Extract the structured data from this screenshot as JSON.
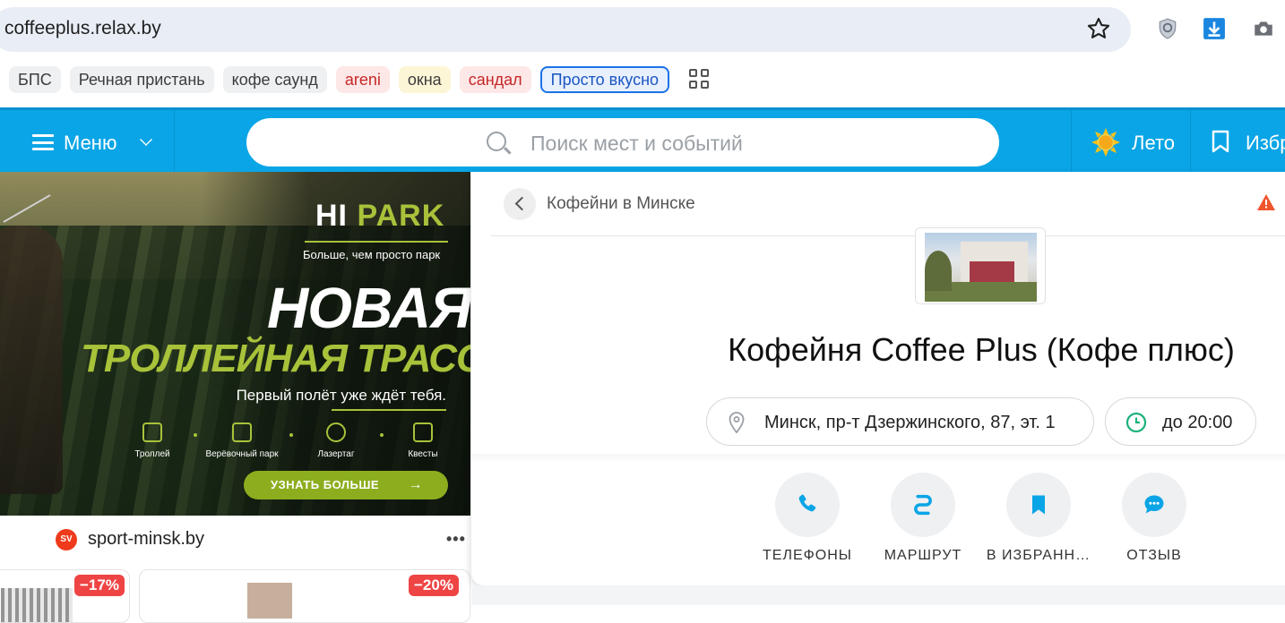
{
  "browser": {
    "url": "coffeeplus.relax.by",
    "bookmarks": [
      {
        "label": "БПС",
        "style": "plain"
      },
      {
        "label": "Речная пристань",
        "style": "plain"
      },
      {
        "label": "кофе саунд",
        "style": "plain"
      },
      {
        "label": "areni",
        "style": "red"
      },
      {
        "label": "окна",
        "style": "yellow"
      },
      {
        "label": "сандал",
        "style": "red"
      },
      {
        "label": "Просто вкусно",
        "style": "selected"
      }
    ]
  },
  "header": {
    "menu_label": "Меню",
    "search_placeholder": "Поиск мест и событий",
    "season_label": "Лето",
    "favorites_label": "Избр"
  },
  "ad": {
    "brand_prefix": "HI",
    "brand_suffix": "PARK",
    "tagline": "Больше, чем просто парк",
    "headline1": "НОВАЯ",
    "headline2": "ТРОЛЛЕЙНАЯ ТРАССА",
    "subline": "Первый полёт уже ждёт тебя.",
    "features": [
      "Троллей",
      "Верёвочный парк",
      "Лазертаг",
      "Квесты"
    ],
    "cta": "УЗНАТЬ БОЛЬШЕ",
    "source_logo": "SV",
    "source_name": "sport-minsk.by",
    "more": "•••",
    "discounts": [
      "−17%",
      "−20%"
    ]
  },
  "venue": {
    "breadcrumb": "Кофейни в Минске",
    "title": "Кофейня Coffee Plus (Кофе плюс)",
    "address": "Минск, пр-т Дзержинского, 87, эт. 1",
    "hours": "до 20:00",
    "actions": [
      {
        "label": "ТЕЛЕФОНЫ",
        "icon": "phone-icon"
      },
      {
        "label": "МАРШРУТ",
        "icon": "route-icon"
      },
      {
        "label": "В ИЗБРАНН…",
        "icon": "bookmark-icon"
      },
      {
        "label": "ОТЗЫВ",
        "icon": "chat-icon"
      }
    ]
  },
  "colors": {
    "header_bg": "#0aa5e6",
    "accent_green": "#a8c23a",
    "icon_blue": "#0aa5e6",
    "badge_red": "#ef4444"
  }
}
